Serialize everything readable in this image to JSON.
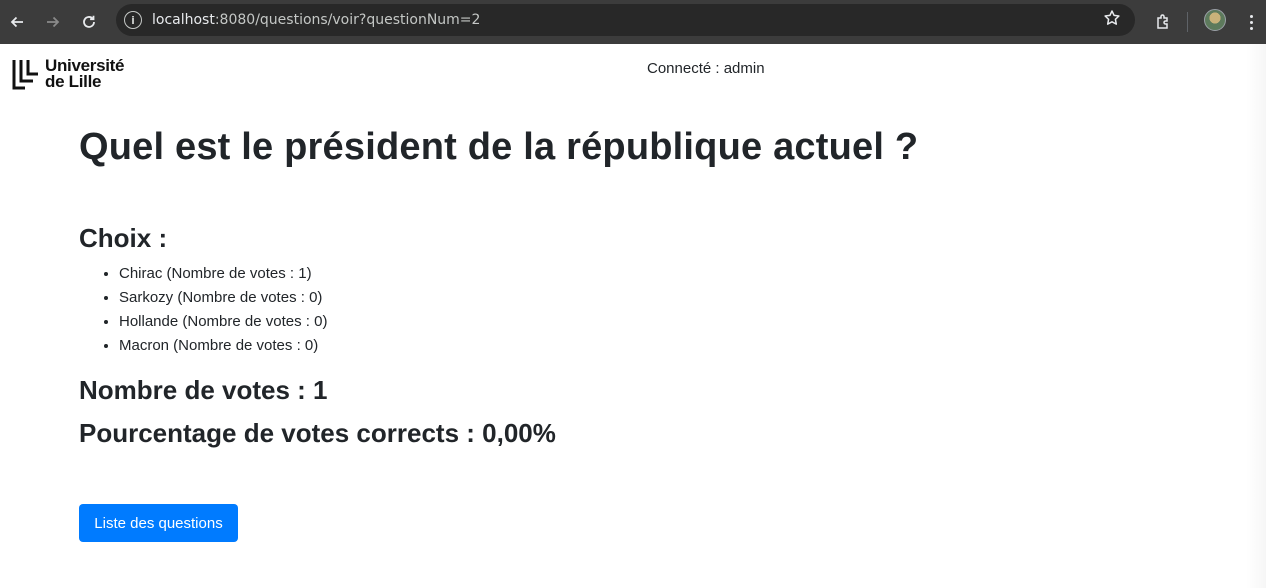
{
  "browser": {
    "url_host": "localhost",
    "url_rest": ":8080/questions/voir?questionNum=2"
  },
  "header": {
    "logo_line1": "Université",
    "logo_line2": "de Lille",
    "connected_text": "Connecté : admin"
  },
  "question": {
    "title": "Quel est le président de la république actuel ?",
    "choices_heading": "Choix :",
    "choices": [
      "Chirac (Nombre de votes : 1)",
      "Sarkozy (Nombre de votes : 0)",
      "Hollande (Nombre de votes : 0)",
      "Macron (Nombre de votes : 0)"
    ],
    "total_votes": "Nombre de votes : 1",
    "correct_percentage": "Pourcentage de votes corrects : 0,00%"
  },
  "actions": {
    "list_button_label": "Liste des questions"
  },
  "colors": {
    "primary": "#007bff",
    "chrome": "#3c3c3c",
    "omnibox": "#282828"
  }
}
